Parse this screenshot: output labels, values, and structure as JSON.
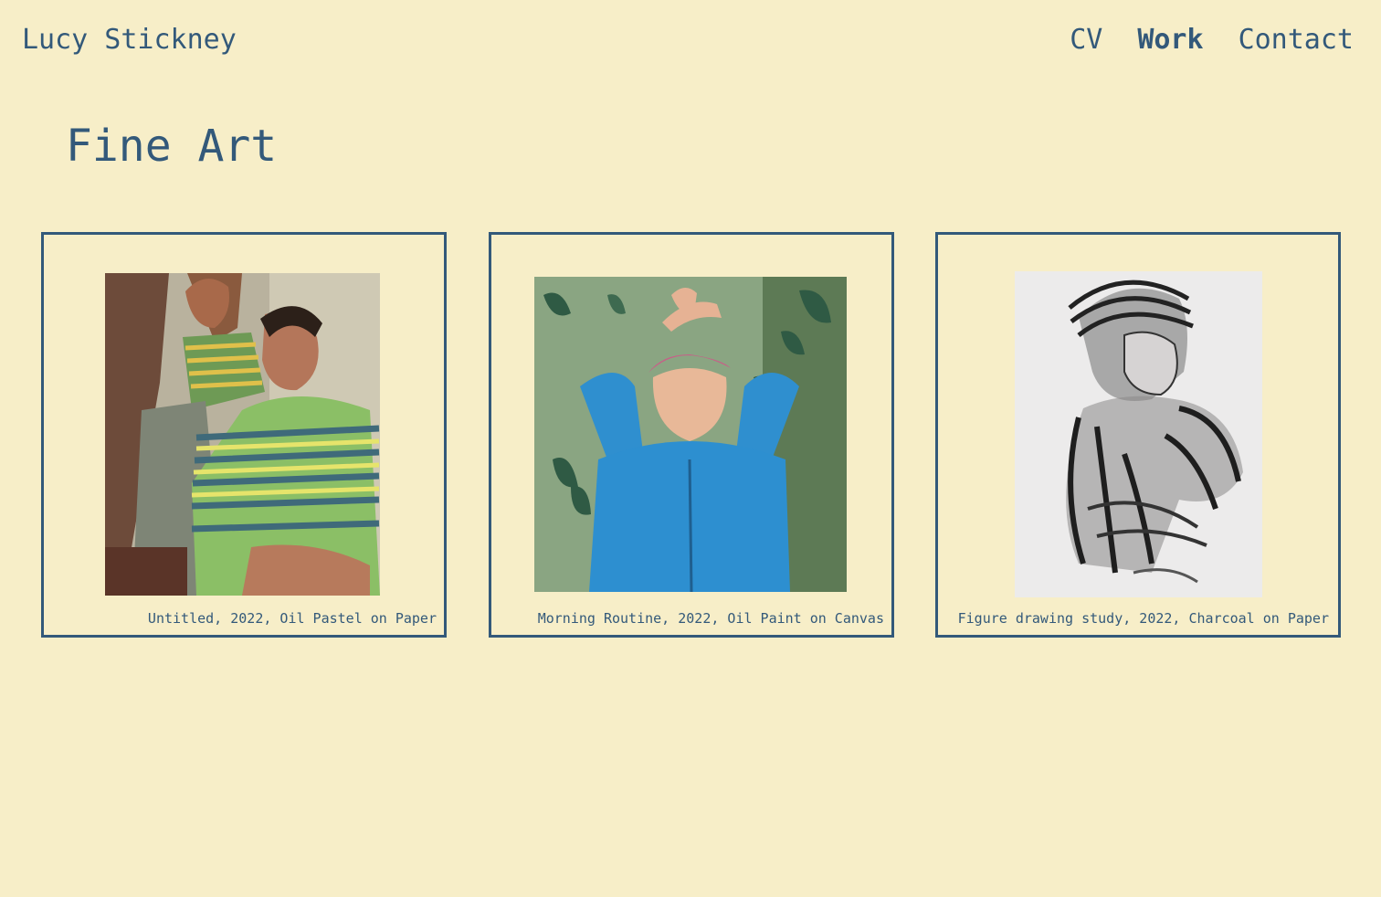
{
  "site": {
    "title": "Lucy Stickney"
  },
  "nav": {
    "items": [
      {
        "label": "CV",
        "active": false
      },
      {
        "label": "Work",
        "active": true
      },
      {
        "label": "Contact",
        "active": false
      }
    ]
  },
  "page": {
    "title": "Fine Art"
  },
  "gallery": {
    "items": [
      {
        "caption": "Untitled, 2022, Oil Pastel on Paper"
      },
      {
        "caption": "Morning Routine, 2022, Oil Paint on Canvas"
      },
      {
        "caption": "Figure drawing study, 2022, Charcoal on Paper"
      }
    ]
  },
  "colors": {
    "background": "#f7eec8",
    "accent": "#33597a"
  }
}
